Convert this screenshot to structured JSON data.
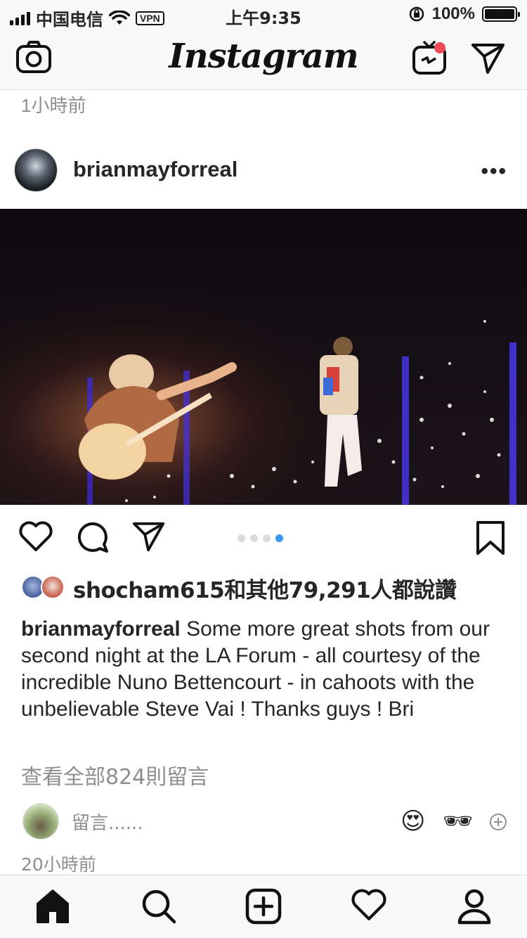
{
  "status_bar": {
    "carrier": "中国电信",
    "vpn": "VPN",
    "time": "上午9:35",
    "battery": "100%",
    "battery_level": 1.0
  },
  "nav": {
    "logo": "Instagram",
    "icons": [
      "camera-icon",
      "igtv-icon",
      "direct-message-icon"
    ]
  },
  "previous_post_time": "1小時前",
  "post": {
    "username": "brianmayforreal",
    "more": "•••",
    "carousel": {
      "total": 4,
      "active": 4
    },
    "likes": "shocham615和其他79,291人都說讚",
    "caption_user": "brianmayforreal",
    "caption_text": " Some more great shots from our second night at the LA Forum - all courtesy of the incredible Nuno Bettencourt - in cahoots with the unbelievable Steve Vai ! Thanks guys ! Bri",
    "view_comments": "查看全部824則留言",
    "comment_placeholder": "留言......",
    "comment_emojis": [
      "😍",
      "🕶"
    ],
    "time": "20小時前"
  },
  "tab_bar": {
    "items": [
      "home-icon",
      "search-icon",
      "new-post-icon",
      "activity-icon",
      "profile-icon"
    ],
    "active": "home-icon"
  },
  "colors": {
    "accent": "#3897f0",
    "notification": "#ed4956",
    "muted": "#8e8e8e",
    "text": "#262626"
  }
}
